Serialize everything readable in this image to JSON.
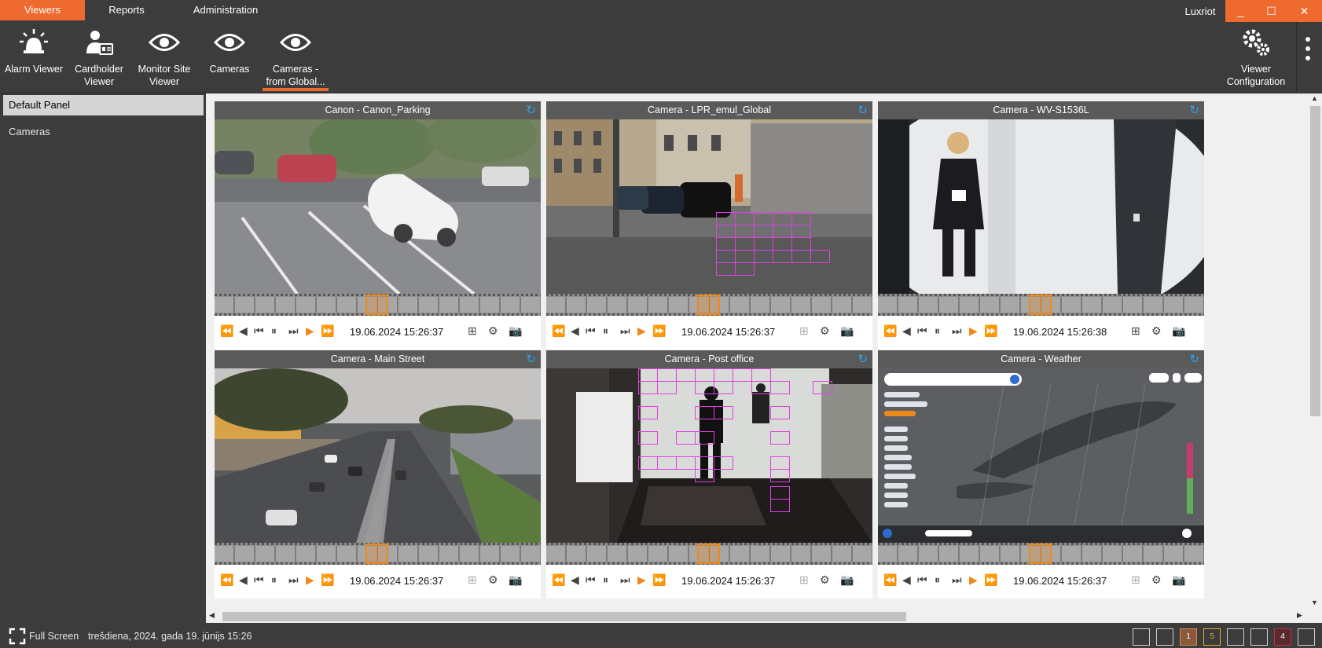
{
  "menu": {
    "tabs": [
      "Viewers",
      "Reports",
      "Administration"
    ],
    "app_name": "Luxriot",
    "window_buttons": [
      "_",
      "☐",
      "✕"
    ]
  },
  "ribbon": {
    "buttons": [
      {
        "label": "Alarm Viewer",
        "icon": "alarm-light-icon"
      },
      {
        "label": "Cardholder\nViewer",
        "icon": "cardholder-icon"
      },
      {
        "label": "Monitor Site\nViewer",
        "icon": "eye-icon"
      },
      {
        "label": "Cameras",
        "icon": "eye-icon"
      },
      {
        "label": "Cameras -\nfrom Global...",
        "icon": "eye-icon"
      }
    ],
    "config_button": {
      "label": "Viewer\nConfiguration",
      "icon": "gears-icon"
    }
  },
  "left_panel": {
    "items": [
      "Default Panel",
      "Cameras"
    ],
    "selected": "Default Panel"
  },
  "tiles": [
    {
      "title": "Canon - Canon_Parking",
      "timestamp": "19.06.2024 15:26:37"
    },
    {
      "title": "Camera - LPR_emul_Global",
      "timestamp": "19.06.2024 15:26:37"
    },
    {
      "title": "Camera - WV-S1536L",
      "timestamp": "19.06.2024 15:26:38"
    },
    {
      "title": "Camera - Main Street",
      "timestamp": "19.06.2024 15:26:37"
    },
    {
      "title": "Camera - Post office",
      "timestamp": "19.06.2024 15:26:37"
    },
    {
      "title": "Camera - Weather",
      "timestamp": "19.06.2024 15:26:37"
    }
  ],
  "status_bar": {
    "fullscreen_label": "Full Screen",
    "date_text": "trešdiena, 2024. gada 19. jūnijs 15:26",
    "layout_buttons": [
      "",
      "",
      "1",
      "5",
      "",
      "",
      "4",
      ""
    ]
  },
  "colors": {
    "accent": "#ee6a2f",
    "timeline_marker": "#ee8a1c",
    "reload_icon": "#2fa3ea",
    "motion_grid": "#e040e0"
  }
}
